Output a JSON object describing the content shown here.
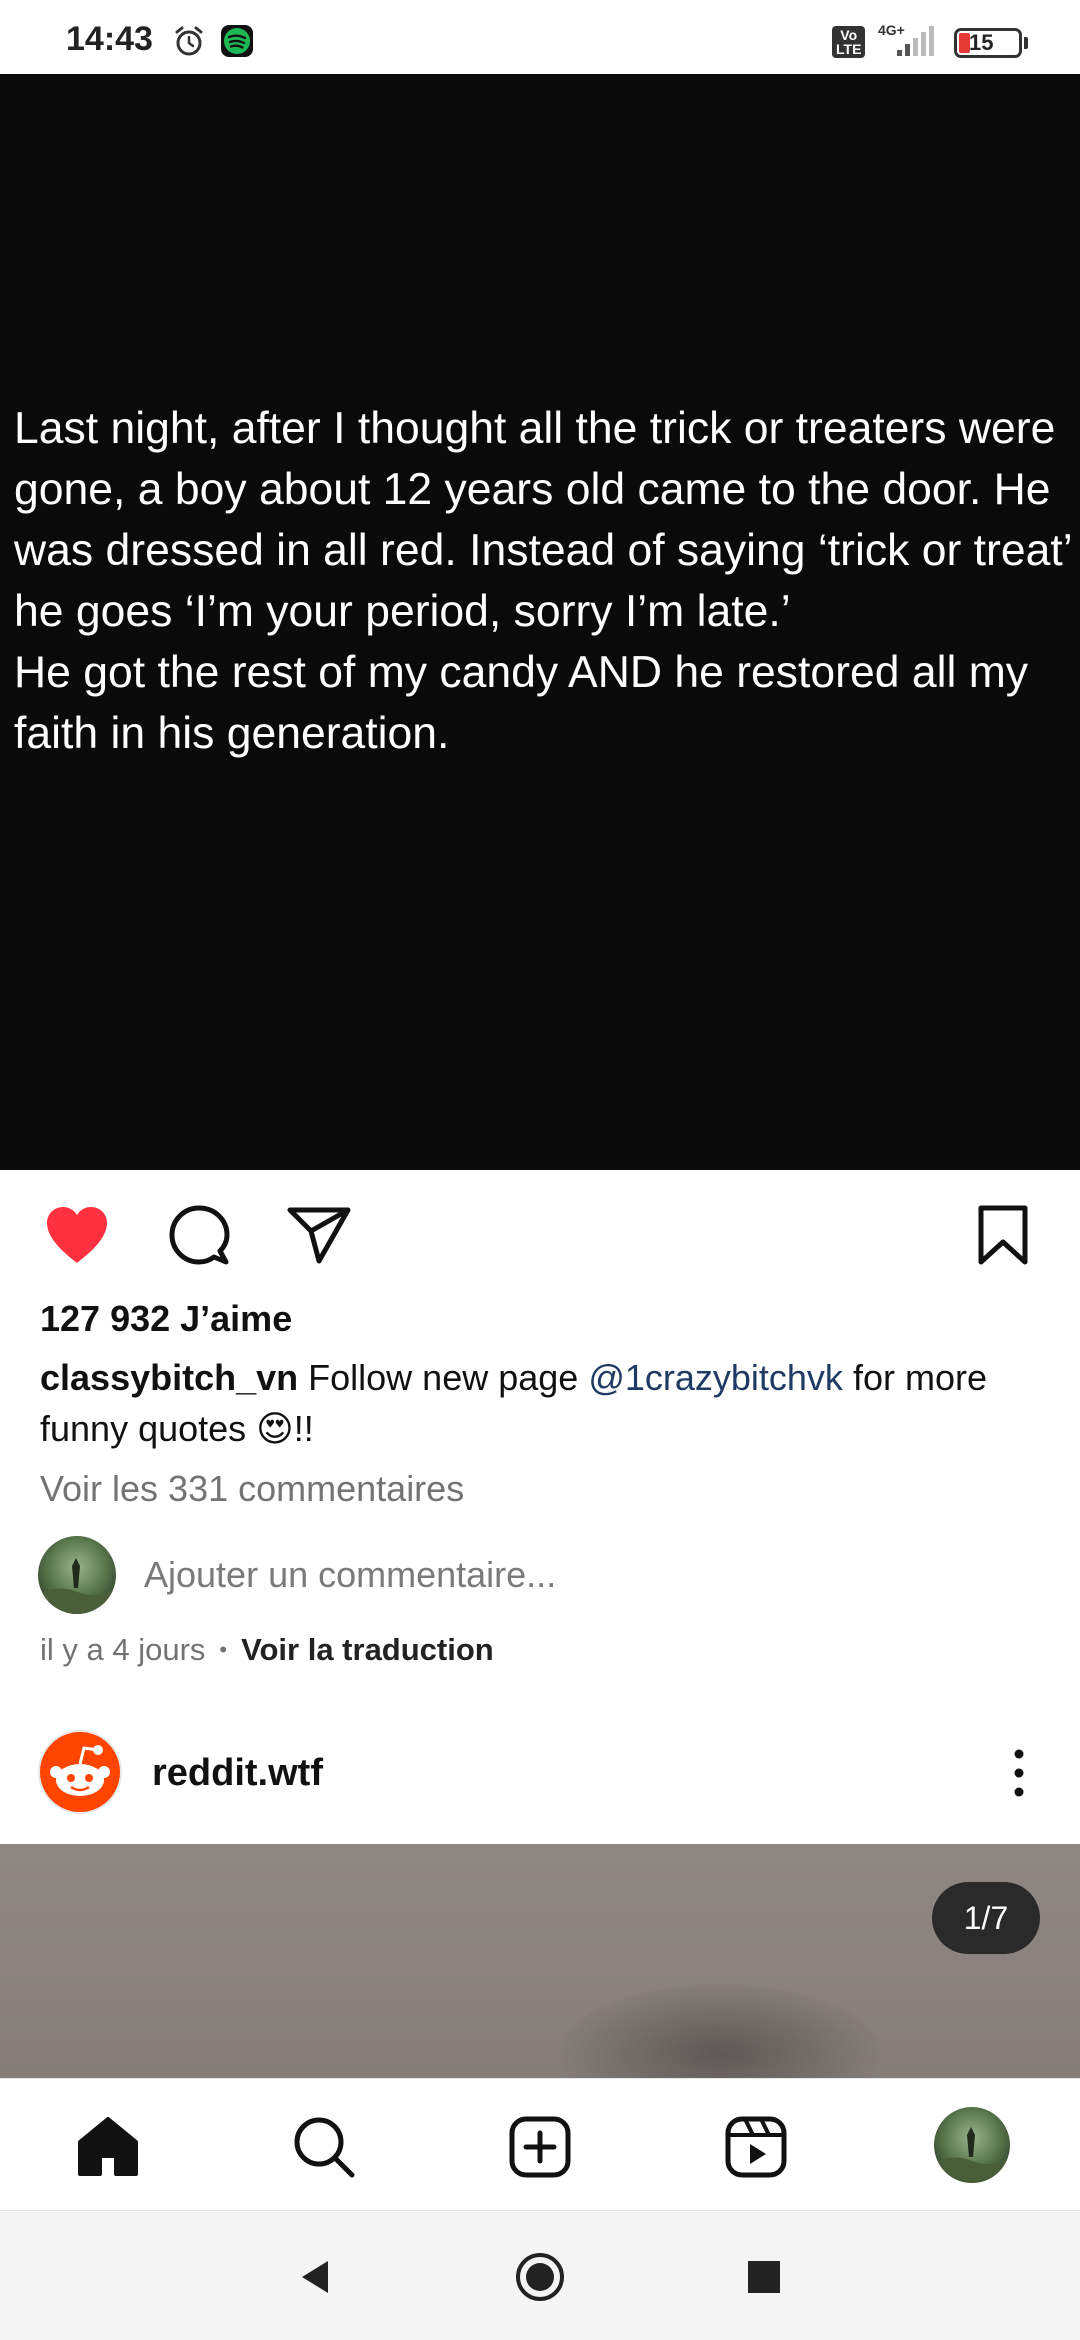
{
  "status_bar": {
    "time": "14:43",
    "network": "4G+",
    "volte": "Vo\nLTE",
    "battery": "15"
  },
  "post": {
    "image_text": "Last night, after I thought all the trick or treaters were gone, a boy about 12 years old came to the door. He was dressed in all red. Instead of saying ‘trick or treat’ he goes ‘I’m your period, sorry I’m late.’\nHe got the rest of my candy AND he restored all my faith in his generation.",
    "likes": "127 932 J’aime",
    "caption_user": "classybitch_vn",
    "caption_text_1": " Follow new page ",
    "caption_mention": "@1crazybitchvk",
    "caption_text_2": " for more funny quotes 😍!!",
    "view_comments": "Voir les 331 commentaires",
    "add_comment_placeholder": "Ajouter un commentaire...",
    "time_ago": "il y a 4 jours",
    "meta_dot": "•",
    "translate": "Voir la traduction"
  },
  "next_post": {
    "username": "reddit.wtf",
    "page_indicator": "1/7"
  },
  "colors": {
    "like_red": "#ff3040",
    "mention_blue": "#1f3b63",
    "reddit_orange": "#ff4500"
  },
  "icons": {
    "like": "heart-filled-icon",
    "comment": "comment-bubble-icon",
    "share": "paper-plane-icon",
    "save": "bookmark-icon",
    "home": "home-icon",
    "search": "search-icon",
    "create": "plus-square-icon",
    "reels": "reels-icon",
    "back": "back-triangle-icon",
    "home_nav": "home-circle-icon",
    "recents": "recents-square-icon"
  }
}
